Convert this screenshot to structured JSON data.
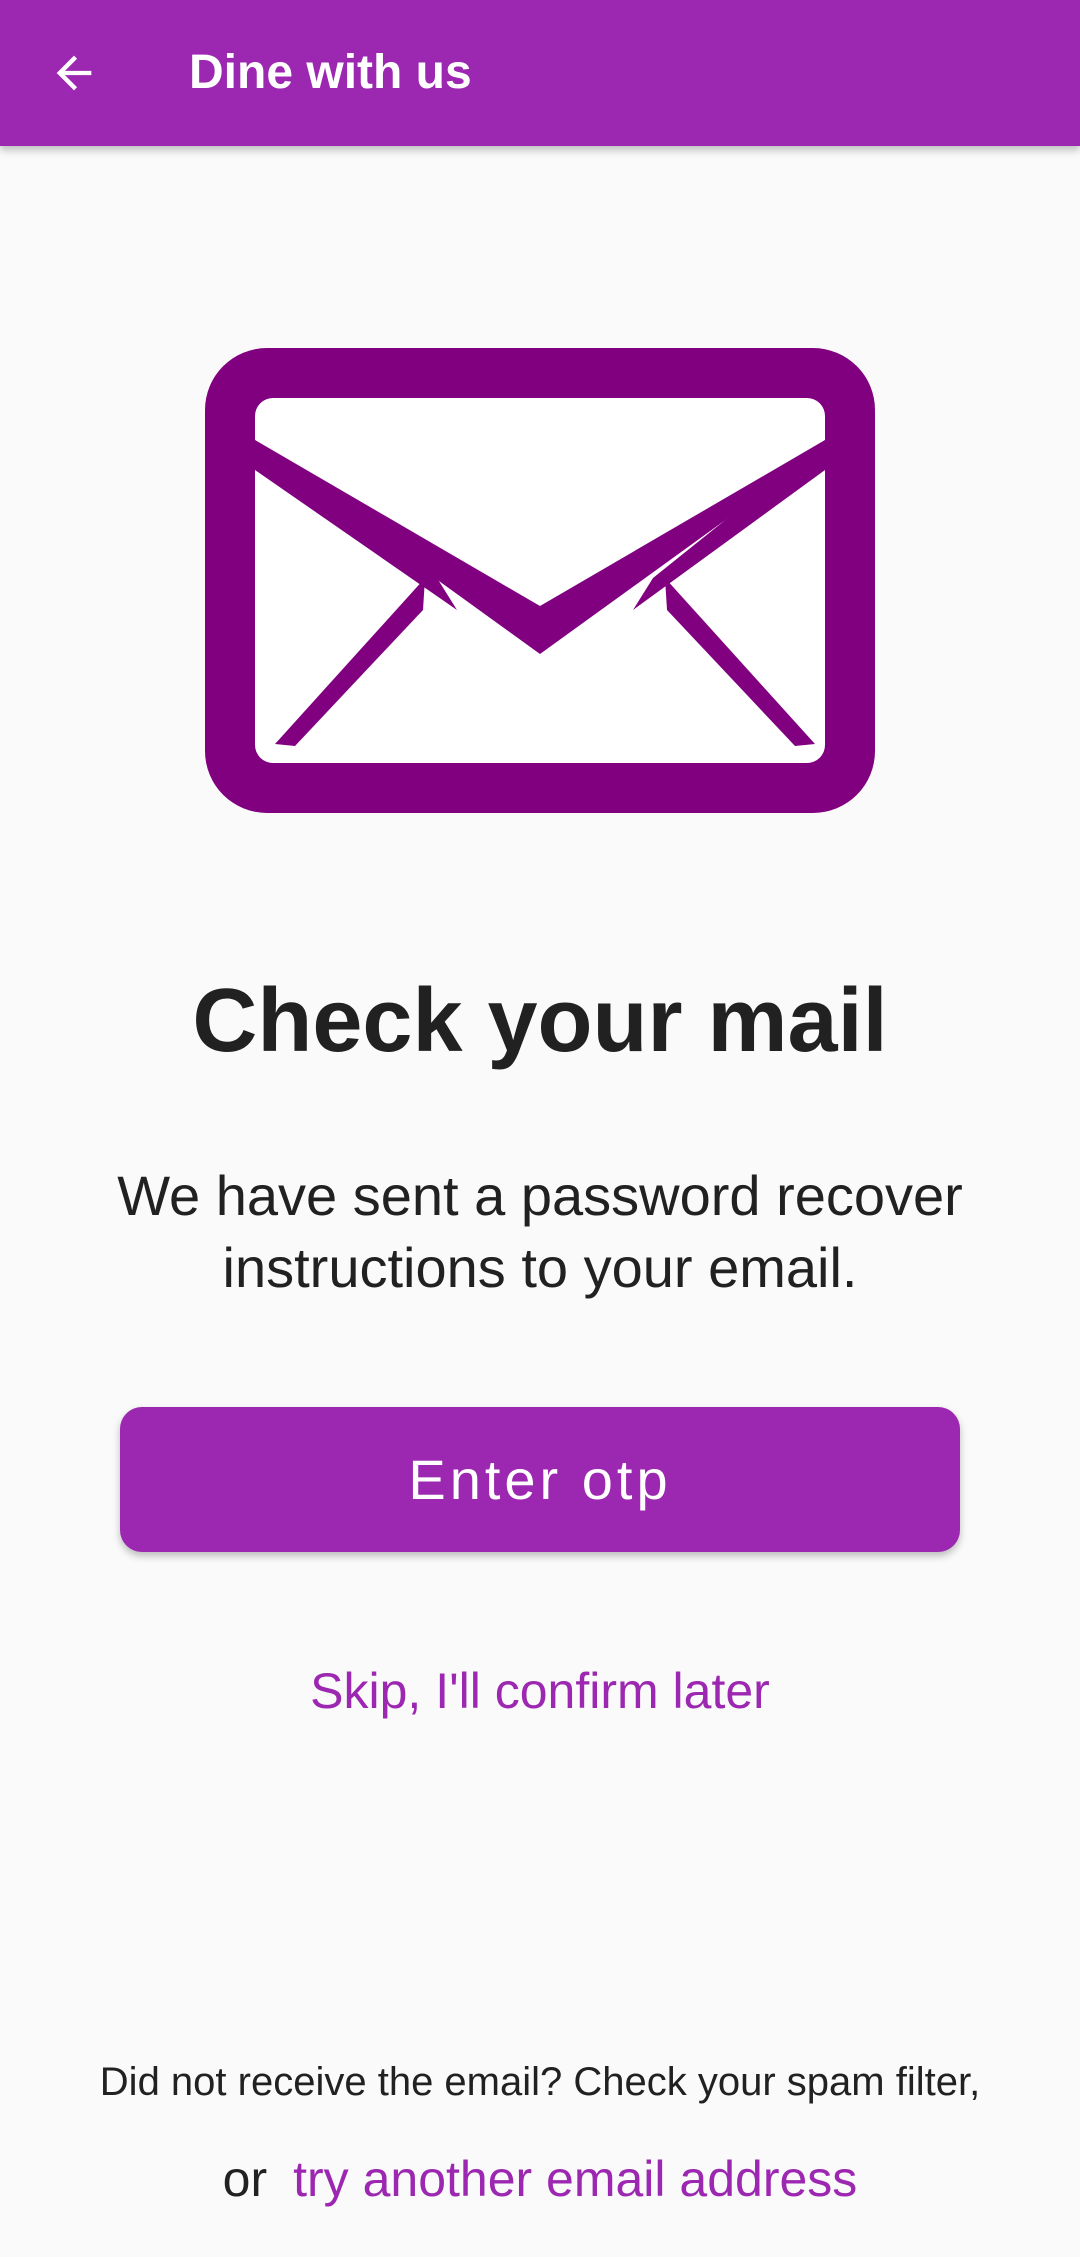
{
  "app_bar": {
    "title": "Dine with us",
    "back_icon": "arrow-back-icon",
    "background_color": "#9c27b0"
  },
  "illustration": {
    "icon": "envelope-icon",
    "color": "#800080"
  },
  "content": {
    "heading": "Check your mail",
    "message": "We have sent a password recover instructions to your email.",
    "primary_button_label": "Enter otp",
    "skip_label": "Skip, I'll confirm later"
  },
  "footer": {
    "note": "Did not receive the email? Check your spam filter,",
    "or_label": "or",
    "alt_link_label": "try another email address"
  },
  "colors": {
    "accent": "#9c27b0",
    "text": "#212121",
    "background": "#fafafa"
  }
}
